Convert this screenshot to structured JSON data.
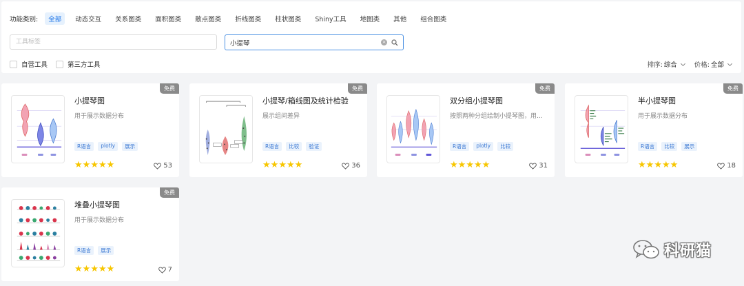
{
  "filters": {
    "category_label": "功能类别:",
    "categories": [
      "全部",
      "动态交互",
      "关系图类",
      "面积图类",
      "散点图类",
      "折线图类",
      "柱状图类",
      "Shiny工具",
      "地图类",
      "其他",
      "组合图类"
    ],
    "active_category": "全部",
    "tag_input_placeholder": "工具标签",
    "search_value": "小提琴",
    "checkboxes": [
      "自营工具",
      "第三方工具"
    ],
    "sort_label": "排序:",
    "sort_value": "综合",
    "price_label": "价格:",
    "price_value": "全部"
  },
  "cards": [
    {
      "title": "小提琴图",
      "desc": "用于展示数据分布",
      "tags": [
        "R语言",
        "plotly",
        "展示"
      ],
      "badge": "免费",
      "stars": 5,
      "likes": "53",
      "thumb_icon": "violin-plot-thumbnail"
    },
    {
      "title": "小提琴/箱线图及统计检验",
      "desc": "展示组间差异",
      "tags": [
        "R语言",
        "比较",
        "验证"
      ],
      "badge": "免费",
      "stars": 5,
      "likes": "36",
      "thumb_icon": "violin-boxplot-stats-thumbnail"
    },
    {
      "title": "双分组小提琴图",
      "desc": "按照两种分组绘制小提琴图，用...",
      "tags": [
        "R语言",
        "plotly",
        "比较"
      ],
      "badge": "免费",
      "stars": 5,
      "likes": "31",
      "thumb_icon": "grouped-violin-thumbnail"
    },
    {
      "title": "半小提琴图",
      "desc": "用于展示数据分布",
      "tags": [
        "R语言",
        "比较",
        "展示"
      ],
      "badge": "免费",
      "stars": 5,
      "likes": "18",
      "thumb_icon": "half-violin-thumbnail"
    },
    {
      "title": "堆叠小提琴图",
      "desc": "用于展示数据分布",
      "tags": [
        "R语言",
        "展示"
      ],
      "badge": "免费",
      "stars": 5,
      "likes": "7",
      "thumb_icon": "stacked-violin-thumbnail"
    }
  ],
  "watermark": {
    "text": "科研猫",
    "icon": "wechat-icon"
  },
  "colors": {
    "accent": "#1a73e8",
    "star": "#f7c600",
    "badge": "#8a8a8a",
    "tag_bg": "#eaf2fc"
  }
}
